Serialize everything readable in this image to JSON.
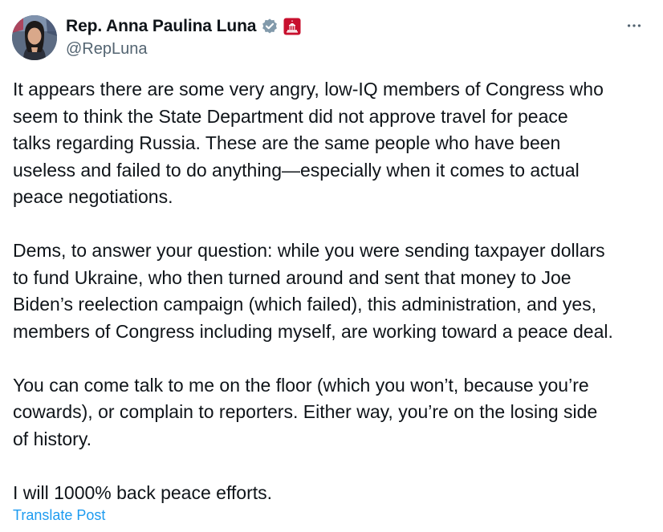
{
  "author": {
    "display_name": "Rep. Anna Paulina Luna",
    "handle": "@RepLuna",
    "avatar_icon": "user-avatar-photo",
    "verified_icon": "gray-verified-badge-icon",
    "affiliation_icon": "us-capitol-badge-icon"
  },
  "menu": {
    "more_icon": "more-options-icon"
  },
  "post": {
    "paragraphs": [
      "It appears there are some very angry, low-IQ members of Congress who\nseem to think the State Department did not approve travel for peace\ntalks regarding Russia. These are the same people who have been\nuseless and failed to do anything—especially when it comes to actual\npeace negotiations.",
      "Dems, to answer your question: while you were sending taxpayer dollars\nto fund Ukraine, who then turned around and sent that money to Joe\nBiden’s reelection campaign (which failed), this administration, and yes,\nmembers of Congress including myself, are working toward a peace deal.",
      "You can come talk to me on the floor (which you won’t, because you’re\ncowards), or complain to reporters. Either way, you’re on the losing side\nof history.",
      "I will 1000% back peace efforts."
    ],
    "translate_label": "Translate Post"
  },
  "colors": {
    "text": "#0f1419",
    "secondary": "#536471",
    "link": "#1d9bf0",
    "gov_badge": "#c8102e",
    "verified_badge": "#829aab"
  }
}
